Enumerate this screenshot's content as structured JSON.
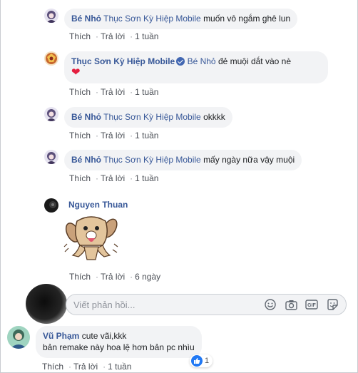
{
  "action_labels": {
    "like": "Thích",
    "reply": "Trả lời"
  },
  "comments": [
    {
      "author": "Bé Nhỏ",
      "tag": "Thục Sơn Kỳ Hiệp Mobile",
      "text": "muốn vô ngắm ghê lun",
      "time": "1 tuần"
    },
    {
      "author": "Thục Sơn Kỳ Hiệp Mobile",
      "tag": "Bé Nhỏ",
      "text": "đẻ muội dắt vào nè",
      "emoji": "❤",
      "time": "1 tuần"
    },
    {
      "author": "Bé Nhỏ",
      "tag": "Thục Sơn Kỳ Hiệp Mobile",
      "text": "okkkk",
      "time": "1 tuần"
    },
    {
      "author": "Bé Nhỏ",
      "tag": "Thục Sơn Kỳ Hiệp Mobile",
      "text": "mấy ngày nữa vậy muội",
      "time": "1 tuần"
    },
    {
      "author": "Nguyen Thuan",
      "time": "6 ngày"
    }
  ],
  "reply_box": {
    "placeholder": "Viết phản hồi..."
  },
  "last_comment": {
    "author": "Vũ Phạm",
    "line1": "cute vãi,kkk",
    "line2": "bản remake này hoa lệ hơn bản pc nhìu",
    "time": "1 tuần",
    "like_count": "1"
  },
  "colors": {
    "author": "#385898",
    "bubble": "#f2f3f5",
    "like_blue": "#2078f4",
    "heart": "#e41e3f"
  }
}
